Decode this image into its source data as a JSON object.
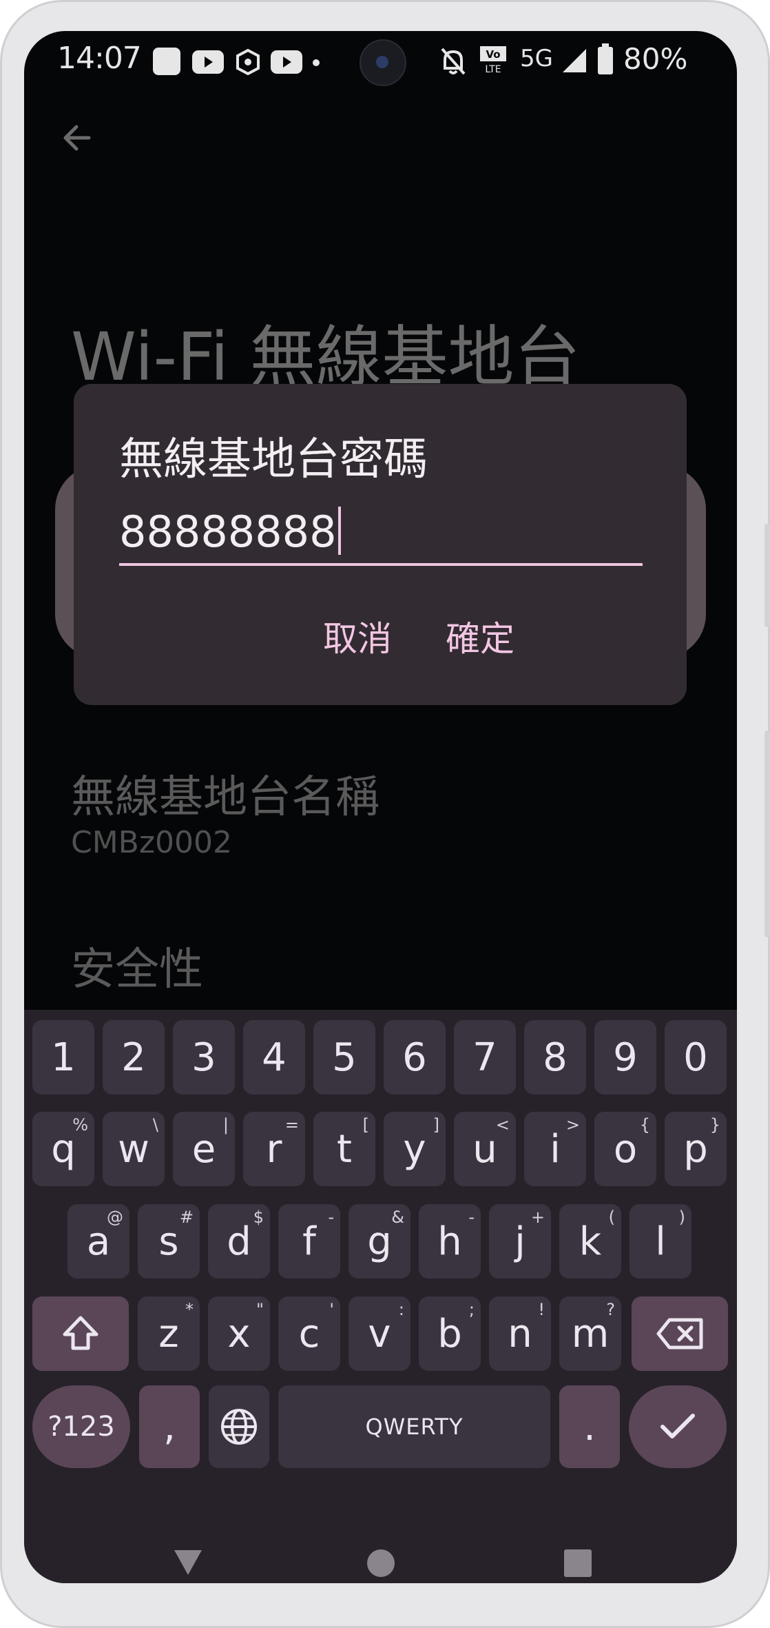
{
  "status_bar": {
    "time": "14:07",
    "network": "5G",
    "battery": "80%",
    "icons": [
      "gallery-icon",
      "youtube-icon",
      "hexagon-app-icon",
      "youtube-icon",
      "dot-icon",
      "bell-off-icon",
      "volte-icon",
      "signal-icon",
      "battery-icon"
    ]
  },
  "page": {
    "title": "Wi-Fi 無線基地台",
    "hotspot_name_label": "無線基地台名稱",
    "hotspot_name_value": "CMBz0002",
    "security_label": "安全性"
  },
  "dialog": {
    "title": "無線基地台密碼",
    "password_value": "88888888",
    "cancel_label": "取消",
    "ok_label": "確定",
    "accent_color": "#f0c6e2"
  },
  "keyboard": {
    "number_row": [
      "1",
      "2",
      "3",
      "4",
      "5",
      "6",
      "7",
      "8",
      "9",
      "0"
    ],
    "row1": [
      {
        "k": "q",
        "a": "%"
      },
      {
        "k": "w",
        "a": "\\"
      },
      {
        "k": "e",
        "a": "|"
      },
      {
        "k": "r",
        "a": "="
      },
      {
        "k": "t",
        "a": "["
      },
      {
        "k": "y",
        "a": "]"
      },
      {
        "k": "u",
        "a": "<"
      },
      {
        "k": "i",
        "a": ">"
      },
      {
        "k": "o",
        "a": "{"
      },
      {
        "k": "p",
        "a": "}"
      }
    ],
    "row2": [
      {
        "k": "a",
        "a": "@"
      },
      {
        "k": "s",
        "a": "#"
      },
      {
        "k": "d",
        "a": "$"
      },
      {
        "k": "f",
        "a": "-"
      },
      {
        "k": "g",
        "a": "&"
      },
      {
        "k": "h",
        "a": "-"
      },
      {
        "k": "j",
        "a": "+"
      },
      {
        "k": "k",
        "a": "("
      },
      {
        "k": "l",
        "a": ")"
      }
    ],
    "row3": [
      {
        "k": "z",
        "a": "*"
      },
      {
        "k": "x",
        "a": "\""
      },
      {
        "k": "c",
        "a": "'"
      },
      {
        "k": "v",
        "a": ":"
      },
      {
        "k": "b",
        "a": ";"
      },
      {
        "k": "n",
        "a": "!"
      },
      {
        "k": "m",
        "a": "?"
      }
    ],
    "symbols_label": "?123",
    "comma_label": ",",
    "space_label": "QWERTY",
    "period_label": "."
  },
  "colors": {
    "screen_bg": "#050608",
    "dialog_bg": "#322c32",
    "keyboard_bg": "#27222a",
    "key_bg": "#3a3340",
    "fn_key_bg": "#5a4657"
  }
}
